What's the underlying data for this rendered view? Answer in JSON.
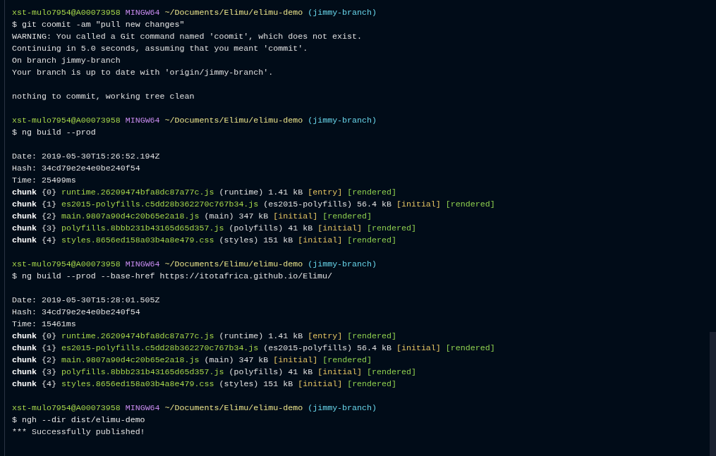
{
  "terminal": {
    "paragraphs": [
      [
        [
          {
            "kind": "userhost",
            "text": "xst-mulo7954@A00073958"
          },
          {
            "kind": "shell",
            "text": "MINGW64"
          },
          {
            "kind": "path",
            "text": "~/Documents/Elimu/elimu-demo"
          },
          {
            "kind": "branch",
            "text": "(jimmy-branch)"
          }
        ],
        [
          {
            "kind": "command",
            "text": "$ git coomit -am \"pull new changes\""
          }
        ],
        [
          {
            "kind": "output",
            "text": "WARNING: You called a Git command named 'coomit', which does not exist."
          }
        ],
        [
          {
            "kind": "output",
            "text": "Continuing in 5.0 seconds, assuming that you meant 'commit'."
          }
        ],
        [
          {
            "kind": "output",
            "text": "On branch jimmy-branch"
          }
        ],
        [
          {
            "kind": "output",
            "text": "Your branch is up to date with 'origin/jimmy-branch'."
          }
        ]
      ],
      [
        [
          {
            "kind": "output",
            "text": "nothing to commit, working tree clean"
          }
        ]
      ],
      [
        [
          {
            "kind": "userhost",
            "text": "xst-mulo7954@A00073958"
          },
          {
            "kind": "shell",
            "text": "MINGW64"
          },
          {
            "kind": "path",
            "text": "~/Documents/Elimu/elimu-demo"
          },
          {
            "kind": "branch",
            "text": "(jimmy-branch)"
          }
        ],
        [
          {
            "kind": "command",
            "text": "$ ng build --prod"
          }
        ]
      ],
      [
        [
          {
            "kind": "output",
            "text": "Date: 2019-05-30T15:26:52.194Z"
          }
        ],
        [
          {
            "kind": "output",
            "text": "Hash: 34cd79e2e4e0be240f54"
          }
        ],
        [
          {
            "kind": "output",
            "text": "Time: 25499ms"
          }
        ],
        [
          {
            "kind": "chunk",
            "text": "chunk"
          },
          {
            "kind": "output",
            "text": "{0}"
          },
          {
            "kind": "file",
            "text": "runtime.26209474bfa8dc87a77c.js"
          },
          {
            "kind": "output",
            "text": "(runtime) 1.41 kB"
          },
          {
            "kind": "tag",
            "text": "[entry]"
          },
          {
            "kind": "rendered",
            "text": "[rendered]"
          }
        ],
        [
          {
            "kind": "chunk",
            "text": "chunk"
          },
          {
            "kind": "output",
            "text": "{1}"
          },
          {
            "kind": "file",
            "text": "es2015-polyfills.c5dd28b362270c767b34.js"
          },
          {
            "kind": "output",
            "text": "(es2015-polyfills) 56.4 kB"
          },
          {
            "kind": "tag",
            "text": "[initial]"
          },
          {
            "kind": "rendered",
            "text": "[rendered]"
          }
        ],
        [
          {
            "kind": "chunk",
            "text": "chunk"
          },
          {
            "kind": "output",
            "text": "{2}"
          },
          {
            "kind": "file",
            "text": "main.9807a90d4c20b65e2a18.js"
          },
          {
            "kind": "output",
            "text": "(main) 347 kB"
          },
          {
            "kind": "tag",
            "text": "[initial]"
          },
          {
            "kind": "rendered",
            "text": "[rendered]"
          }
        ],
        [
          {
            "kind": "chunk",
            "text": "chunk"
          },
          {
            "kind": "output",
            "text": "{3}"
          },
          {
            "kind": "file",
            "text": "polyfills.8bbb231b43165d65d357.js"
          },
          {
            "kind": "output",
            "text": "(polyfills) 41 kB"
          },
          {
            "kind": "tag",
            "text": "[initial]"
          },
          {
            "kind": "rendered",
            "text": "[rendered]"
          }
        ],
        [
          {
            "kind": "chunk",
            "text": "chunk"
          },
          {
            "kind": "output",
            "text": "{4}"
          },
          {
            "kind": "file",
            "text": "styles.8656ed158a03b4a8e479.css"
          },
          {
            "kind": "output",
            "text": "(styles) 151 kB"
          },
          {
            "kind": "tag",
            "text": "[initial]"
          },
          {
            "kind": "rendered",
            "text": "[rendered]"
          }
        ]
      ],
      [
        [
          {
            "kind": "userhost",
            "text": "xst-mulo7954@A00073958"
          },
          {
            "kind": "shell",
            "text": "MINGW64"
          },
          {
            "kind": "path",
            "text": "~/Documents/Elimu/elimu-demo"
          },
          {
            "kind": "branch",
            "text": "(jimmy-branch)"
          }
        ],
        [
          {
            "kind": "command",
            "text": "$ ng build --prod --base-href https://itotafrica.github.io/Elimu/"
          }
        ]
      ],
      [
        [
          {
            "kind": "output",
            "text": "Date: 2019-05-30T15:28:01.505Z"
          }
        ],
        [
          {
            "kind": "output",
            "text": "Hash: 34cd79e2e4e0be240f54"
          }
        ],
        [
          {
            "kind": "output",
            "text": "Time: 15461ms"
          }
        ],
        [
          {
            "kind": "chunk",
            "text": "chunk"
          },
          {
            "kind": "output",
            "text": "{0}"
          },
          {
            "kind": "file",
            "text": "runtime.26209474bfa8dc87a77c.js"
          },
          {
            "kind": "output",
            "text": "(runtime) 1.41 kB"
          },
          {
            "kind": "tag",
            "text": "[entry]"
          },
          {
            "kind": "rendered",
            "text": "[rendered]"
          }
        ],
        [
          {
            "kind": "chunk",
            "text": "chunk"
          },
          {
            "kind": "output",
            "text": "{1}"
          },
          {
            "kind": "file",
            "text": "es2015-polyfills.c5dd28b362270c767b34.js"
          },
          {
            "kind": "output",
            "text": "(es2015-polyfills) 56.4 kB"
          },
          {
            "kind": "tag",
            "text": "[initial]"
          },
          {
            "kind": "rendered",
            "text": "[rendered]"
          }
        ],
        [
          {
            "kind": "chunk",
            "text": "chunk"
          },
          {
            "kind": "output",
            "text": "{2}"
          },
          {
            "kind": "file",
            "text": "main.9807a90d4c20b65e2a18.js"
          },
          {
            "kind": "output",
            "text": "(main) 347 kB"
          },
          {
            "kind": "tag",
            "text": "[initial]"
          },
          {
            "kind": "rendered",
            "text": "[rendered]"
          }
        ],
        [
          {
            "kind": "chunk",
            "text": "chunk"
          },
          {
            "kind": "output",
            "text": "{3}"
          },
          {
            "kind": "file",
            "text": "polyfills.8bbb231b43165d65d357.js"
          },
          {
            "kind": "output",
            "text": "(polyfills) 41 kB"
          },
          {
            "kind": "tag",
            "text": "[initial]"
          },
          {
            "kind": "rendered",
            "text": "[rendered]"
          }
        ],
        [
          {
            "kind": "chunk",
            "text": "chunk"
          },
          {
            "kind": "output",
            "text": "{4}"
          },
          {
            "kind": "file",
            "text": "styles.8656ed158a03b4a8e479.css"
          },
          {
            "kind": "output",
            "text": "(styles) 151 kB"
          },
          {
            "kind": "tag",
            "text": "[initial]"
          },
          {
            "kind": "rendered",
            "text": "[rendered]"
          }
        ]
      ],
      [
        [
          {
            "kind": "userhost",
            "text": "xst-mulo7954@A00073958"
          },
          {
            "kind": "shell",
            "text": "MINGW64"
          },
          {
            "kind": "path",
            "text": "~/Documents/Elimu/elimu-demo"
          },
          {
            "kind": "branch",
            "text": "(jimmy-branch)"
          }
        ],
        [
          {
            "kind": "command",
            "text": "$ ngh --dir dist/elimu-demo"
          }
        ],
        [
          {
            "kind": "output",
            "text": "*** Successfully published!"
          }
        ]
      ]
    ]
  }
}
